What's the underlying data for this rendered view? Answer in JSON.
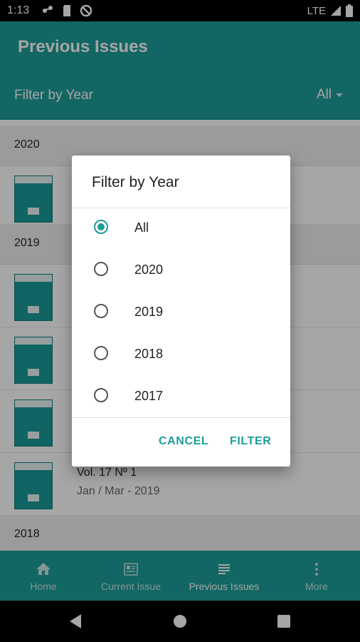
{
  "status_bar": {
    "time": "1:13",
    "network": "LTE"
  },
  "app_bar": {
    "title": "Previous Issues",
    "filter_label": "Filter by Year",
    "filter_value": "All"
  },
  "sections": [
    {
      "year": "2020"
    },
    {
      "year": "2019"
    },
    {
      "year": "2018"
    }
  ],
  "issues": [
    {
      "title": "",
      "date": ""
    },
    {
      "title": "",
      "date": ""
    },
    {
      "title": "",
      "date": ""
    },
    {
      "title": "",
      "date": ""
    },
    {
      "title": "Vol. 17 Nº 1",
      "date": "Jan / Mar - 2019"
    }
  ],
  "dialog": {
    "title": "Filter by Year",
    "options": [
      {
        "label": "All",
        "selected": true
      },
      {
        "label": "2020",
        "selected": false
      },
      {
        "label": "2019",
        "selected": false
      },
      {
        "label": "2018",
        "selected": false
      },
      {
        "label": "2017",
        "selected": false
      }
    ],
    "cancel_label": "CANCEL",
    "filter_label": "FILTER"
  },
  "bottom_nav": [
    {
      "label": "Home",
      "icon": "home-icon"
    },
    {
      "label": "Current Issue",
      "icon": "newspaper-icon"
    },
    {
      "label": "Previous Issues",
      "icon": "list-icon"
    },
    {
      "label": "More",
      "icon": "more-vert-icon"
    }
  ],
  "colors": {
    "accent": "#1d9d99"
  }
}
